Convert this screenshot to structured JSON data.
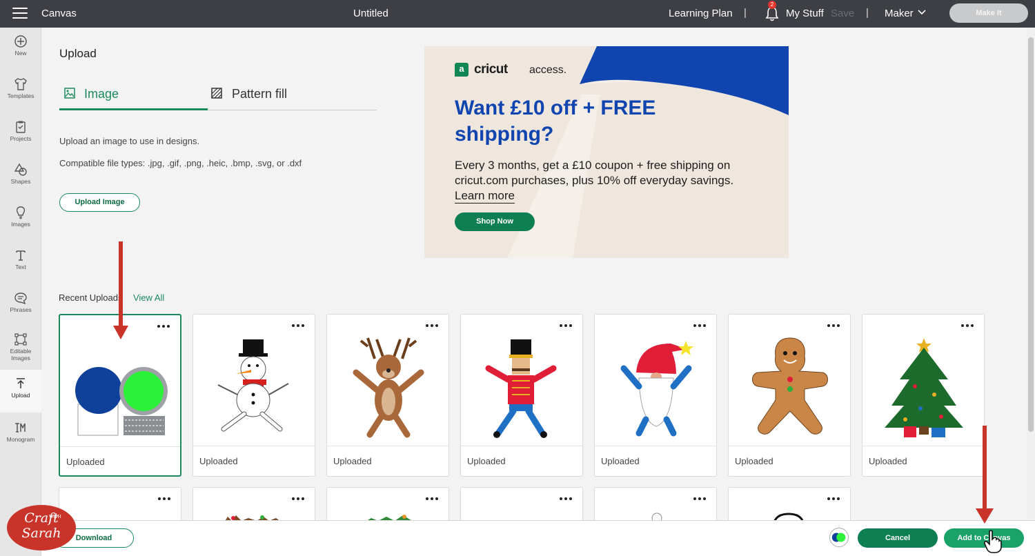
{
  "topbar": {
    "app_name": "Canvas",
    "doc_title": "Untitled",
    "learning": "Learning Plan",
    "separator": "|",
    "notif_count": "2",
    "mystuff": "My Stuff",
    "save": "Save",
    "machine": "Maker",
    "make_it": "Make It"
  },
  "rail": [
    {
      "label": "New",
      "icon": "plus-circle-icon"
    },
    {
      "label": "Templates",
      "icon": "tshirt-icon"
    },
    {
      "label": "Projects",
      "icon": "clipboard-icon"
    },
    {
      "label": "Shapes",
      "icon": "shapes-icon"
    },
    {
      "label": "Images",
      "icon": "lightbulb-icon"
    },
    {
      "label": "Text",
      "icon": "text-icon"
    },
    {
      "label": "Phrases",
      "icon": "speech-bubble-icon"
    },
    {
      "label_1": "Editable",
      "label_2": "Images",
      "icon": "editable-images-icon"
    },
    {
      "label": "Upload",
      "icon": "upload-icon"
    },
    {
      "label": "Monogram",
      "icon": "monogram-icon"
    }
  ],
  "upload": {
    "heading": "Upload",
    "tab_image": "Image",
    "tab_pattern": "Pattern fill",
    "desc_1": "Upload an image to use in designs.",
    "desc_2": "Compatible file types: .jpg, .gif, .png, .heic, .bmp, .svg, or .dxf",
    "upload_button": "Upload Image",
    "recent_label": "Recent Uploads",
    "view_all": "View All"
  },
  "ad": {
    "brand_mark": "a",
    "brand": "cricut",
    "brand_2": "access.",
    "headline": "Want £10 off + FREE shipping?",
    "body": "Every 3 months, get a £10 coupon + free shipping on cricut.com purchases, plus 10% off everyday savings.",
    "link": "Learn more",
    "button": "Shop Now",
    "colors": {
      "blue": "#1045b0",
      "green": "#0e7f52",
      "beige": "#efe6dd"
    }
  },
  "cards": [
    {
      "caption": "Uploaded",
      "image": "snow-globes"
    },
    {
      "caption": "Uploaded",
      "image": "snowman"
    },
    {
      "caption": "Uploaded",
      "image": "reindeer"
    },
    {
      "caption": "Uploaded",
      "image": "nutcracker"
    },
    {
      "caption": "Uploaded",
      "image": "gnome"
    },
    {
      "caption": "Uploaded",
      "image": "gingerbread-man"
    },
    {
      "caption": "Uploaded",
      "image": "christmas-tree"
    }
  ],
  "bottombar": {
    "download": "Download",
    "cancel": "Cancel",
    "add_to_canvas": "Add to Canvas"
  },
  "watermark": {
    "line1": "Craft",
    "line2": "WITH",
    "line3": "Sarah"
  }
}
